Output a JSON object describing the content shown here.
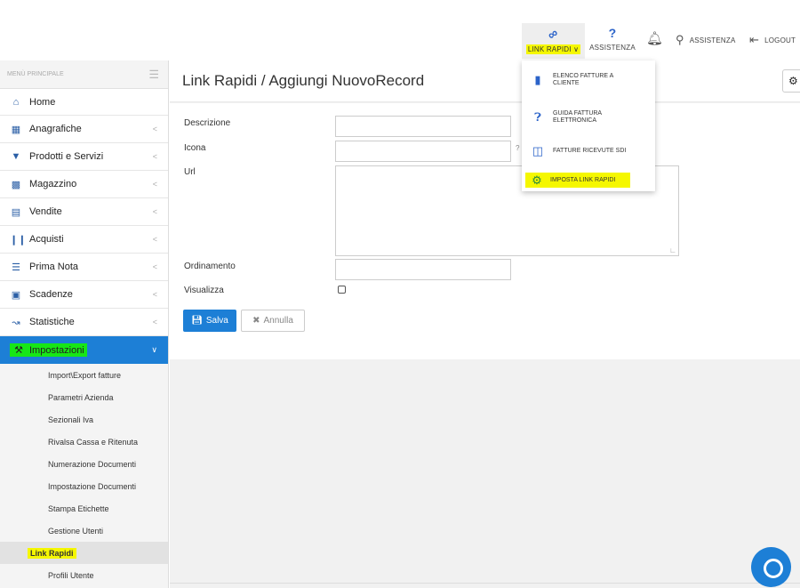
{
  "topbar": {
    "link_rapidi": "LINK RAPIDI",
    "assistenza_q": "ASSISTENZA",
    "assistenza": "ASSISTENZA",
    "logout": "LOGOUT"
  },
  "dropdown": {
    "items": [
      {
        "label": "ELENCO FATTURE A CLIENTE",
        "icon": "document-icon"
      },
      {
        "label": "GUIDA FATTURA ELETTRONICA",
        "icon": "question-circle-icon"
      },
      {
        "label": "FATTURE RICEVUTE SDI",
        "icon": "code-file-icon"
      },
      {
        "label": "IMPOSTA LINK RAPIDI",
        "icon": "gears-icon"
      }
    ]
  },
  "sidebar": {
    "header": "MENÙ PRINCIPALE",
    "items": [
      {
        "label": "Home",
        "icon": "home-icon"
      },
      {
        "label": "Anagrafiche",
        "icon": "id-card-icon"
      },
      {
        "label": "Prodotti e Servizi",
        "icon": "tags-icon"
      },
      {
        "label": "Magazzino",
        "icon": "truck-icon"
      },
      {
        "label": "Vendite",
        "icon": "basket-icon"
      },
      {
        "label": "Acquisti",
        "icon": "barcode-icon"
      },
      {
        "label": "Prima Nota",
        "icon": "list-icon"
      },
      {
        "label": "Scadenze",
        "icon": "money-icon"
      },
      {
        "label": "Statistiche",
        "icon": "chart-line-icon"
      },
      {
        "label": "Impostazioni",
        "icon": "wrench-icon"
      }
    ],
    "submenu": [
      "Import\\Export fatture",
      "Parametri Azienda",
      "Sezionali Iva",
      "Rivalsa Cassa e Ritenuta",
      "Numerazione Documenti",
      "Impostazione Documenti",
      "Stampa Etichette",
      "Gestione Utenti",
      "Link Rapidi",
      "Profili Utente"
    ]
  },
  "page": {
    "title": "Link Rapidi / Aggiungi NuovoRecord",
    "fields": {
      "descrizione": "Descrizione",
      "icona": "Icona",
      "url": "Url",
      "ordinamento": "Ordinamento",
      "visualizza": "Visualizza"
    },
    "icona_hint": "?",
    "save": "Salva",
    "cancel": "Annulla"
  },
  "colors": {
    "accent": "#1d7fd6",
    "highlight_yellow": "#f5f700",
    "highlight_green": "#17e617"
  }
}
